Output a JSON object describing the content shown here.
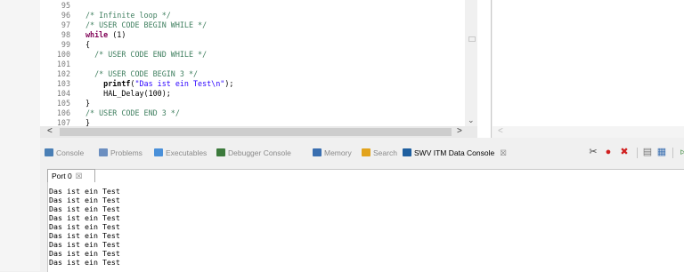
{
  "editor": {
    "lines": [
      {
        "num": "95",
        "parts": []
      },
      {
        "num": "96",
        "parts": [
          {
            "t": "/* Infinite loop */",
            "c": "cmt"
          }
        ]
      },
      {
        "num": "97",
        "parts": [
          {
            "t": "/* USER CODE BEGIN WHILE */",
            "c": "cmt"
          }
        ]
      },
      {
        "num": "98",
        "parts": [
          {
            "t": "while",
            "c": "kw"
          },
          {
            "t": " (1)",
            "c": ""
          }
        ]
      },
      {
        "num": "99",
        "parts": [
          {
            "t": "{",
            "c": ""
          }
        ]
      },
      {
        "num": "100",
        "parts": [
          {
            "t": "  /* USER CODE END WHILE */",
            "c": "cmt"
          }
        ]
      },
      {
        "num": "101",
        "parts": []
      },
      {
        "num": "102",
        "parts": [
          {
            "t": "  /* USER CODE BEGIN 3 */",
            "c": "cmt"
          }
        ]
      },
      {
        "num": "103",
        "parts": [
          {
            "t": "    printf",
            "c": "fn"
          },
          {
            "t": "(",
            "c": ""
          },
          {
            "t": "\"Das ist ein Test\\n\"",
            "c": "str"
          },
          {
            "t": ");",
            "c": ""
          }
        ]
      },
      {
        "num": "104",
        "parts": [
          {
            "t": "    HAL_Delay(100);",
            "c": ""
          }
        ]
      },
      {
        "num": "105",
        "parts": [
          {
            "t": "}",
            "c": ""
          }
        ]
      },
      {
        "num": "106",
        "parts": [
          {
            "t": "/* USER CODE END 3 */",
            "c": "cmt"
          }
        ]
      },
      {
        "num": "107",
        "parts": [
          {
            "t": "}",
            "c": ""
          }
        ]
      }
    ],
    "scroll_left": "<",
    "scroll_right": ">",
    "scroll_down": "⌄",
    "right_scroll_left": "<"
  },
  "console": {
    "tabs": [
      {
        "label": "Console",
        "icon": "console-icon",
        "color": "#4a7fb5"
      },
      {
        "label": "Problems",
        "icon": "problems-icon",
        "color": "#6c8fc0"
      },
      {
        "label": "Executables",
        "icon": "executables-icon",
        "color": "#4a90d9"
      },
      {
        "label": "Debugger Console",
        "icon": "debugger-console-icon",
        "color": "#3c7a3c"
      },
      {
        "label": "Memory",
        "icon": "memory-icon",
        "color": "#3a6fb0"
      },
      {
        "label": "Search",
        "icon": "search-icon",
        "color": "#e2a31c"
      },
      {
        "label": "SWV ITM Data Console",
        "icon": "swv-console-icon",
        "color": "#1f5f9f",
        "active": true
      }
    ],
    "active_close": "☒",
    "toolbar": [
      {
        "icon": "tools-icon",
        "glyph": "✂",
        "color": "#444"
      },
      {
        "icon": "record-icon",
        "glyph": "●",
        "color": "#d02020"
      },
      {
        "icon": "clear-icon",
        "glyph": "✖",
        "color": "#d02020"
      },
      {
        "icon": "export-icon",
        "glyph": "▤",
        "color": "#777"
      },
      {
        "icon": "settings-icon",
        "glyph": "▦",
        "color": "#3a6fb0"
      },
      {
        "icon": "more-icon",
        "glyph": "▹",
        "color": "#3a8a3a"
      }
    ],
    "port_tab": "Port 0",
    "port_close": "☒",
    "output": [
      "Das ist ein Test",
      "Das ist ein Test",
      "Das ist ein Test",
      "Das ist ein Test",
      "Das ist ein Test",
      "Das ist ein Test",
      "Das ist ein Test",
      "Das ist ein Test",
      "Das ist ein Test"
    ]
  }
}
